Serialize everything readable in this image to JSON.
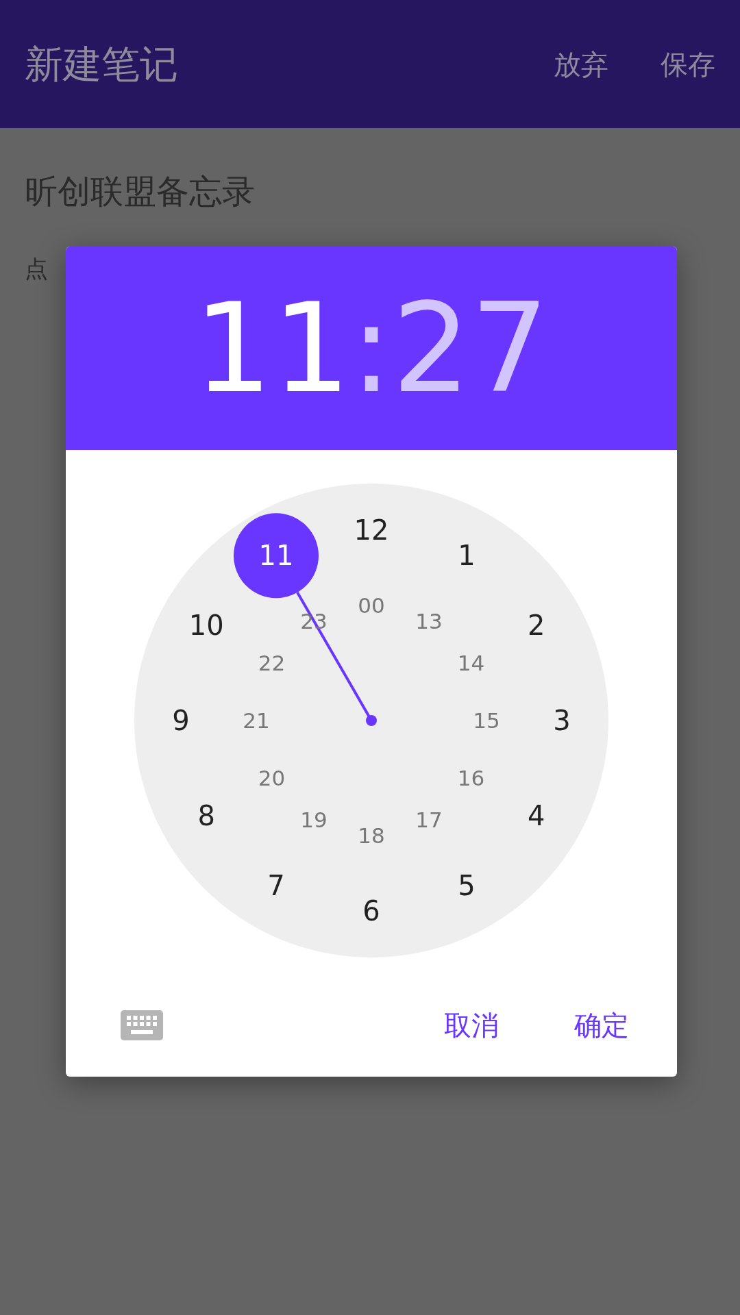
{
  "app_bar": {
    "title": "新建笔记",
    "actions": [
      "放弃",
      "保存"
    ]
  },
  "note": {
    "title": "昕创联盟备忘录",
    "body": "点"
  },
  "time_picker": {
    "hour": {
      "text": "11",
      "selected": true
    },
    "separator": ":",
    "minute": {
      "text": "27",
      "selected": false
    },
    "outer": [
      {
        "label": "12",
        "selected": false
      },
      {
        "label": "1",
        "selected": false
      },
      {
        "label": "2",
        "selected": false
      },
      {
        "label": "3",
        "selected": false
      },
      {
        "label": "4",
        "selected": false
      },
      {
        "label": "5",
        "selected": false
      },
      {
        "label": "6",
        "selected": false
      },
      {
        "label": "7",
        "selected": false
      },
      {
        "label": "8",
        "selected": false
      },
      {
        "label": "9",
        "selected": false
      },
      {
        "label": "10",
        "selected": false
      },
      {
        "label": "11",
        "selected": true
      }
    ],
    "inner": [
      {
        "label": "00",
        "selected": false
      },
      {
        "label": "13",
        "selected": false
      },
      {
        "label": "14",
        "selected": false
      },
      {
        "label": "15",
        "selected": false
      },
      {
        "label": "16",
        "selected": false
      },
      {
        "label": "17",
        "selected": false
      },
      {
        "label": "18",
        "selected": false
      },
      {
        "label": "19",
        "selected": false
      },
      {
        "label": "20",
        "selected": false
      },
      {
        "label": "21",
        "selected": false
      },
      {
        "label": "22",
        "selected": false
      },
      {
        "label": "23",
        "selected": false
      }
    ],
    "buttons": [
      "取消",
      "确定"
    ]
  }
}
